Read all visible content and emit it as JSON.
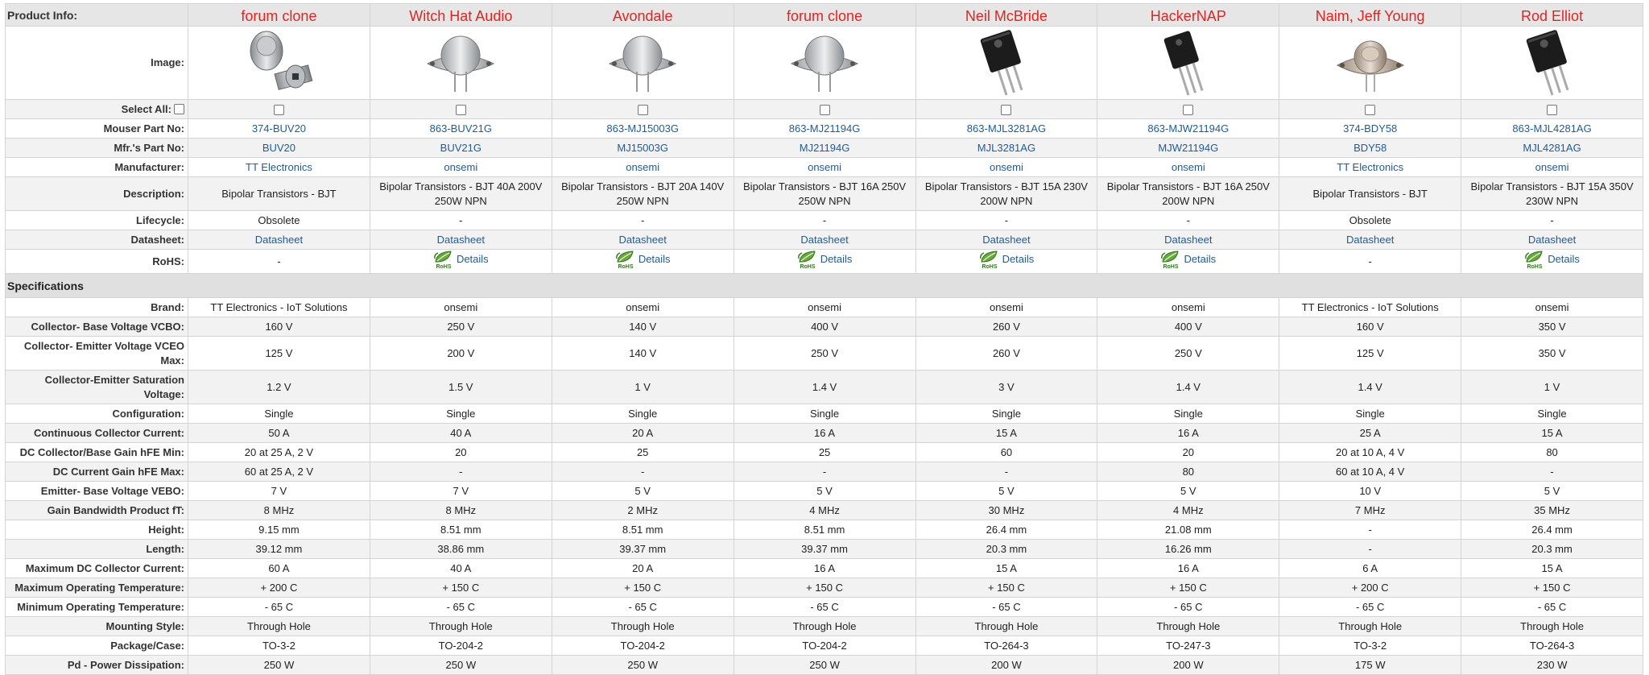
{
  "header_label": "Product Info:",
  "products": [
    {
      "name": "forum clone",
      "image": "to3-pair-image",
      "mouser": "374-BUV20",
      "mfr": "BUV20",
      "manufacturer": "TT Electronics",
      "description": "Bipolar Transistors - BJT",
      "lifecycle": "Obsolete",
      "datasheet": "Datasheet",
      "rohs": "-",
      "rohs_icon": false
    },
    {
      "name": "Witch Hat Audio",
      "image": "to204-image",
      "mouser": "863-BUV21G",
      "mfr": "BUV21G",
      "manufacturer": "onsemi",
      "description": "Bipolar Transistors - BJT 40A 200V 250W NPN",
      "lifecycle": "-",
      "datasheet": "Datasheet",
      "rohs": "Details",
      "rohs_icon": true
    },
    {
      "name": "Avondale",
      "image": "to204-image",
      "mouser": "863-MJ15003G",
      "mfr": "MJ15003G",
      "manufacturer": "onsemi",
      "description": "Bipolar Transistors - BJT 20A 140V 250W NPN",
      "lifecycle": "-",
      "datasheet": "Datasheet",
      "rohs": "Details",
      "rohs_icon": true
    },
    {
      "name": "forum clone",
      "image": "to204-image",
      "mouser": "863-MJ21194G",
      "mfr": "MJ21194G",
      "manufacturer": "onsemi",
      "description": "Bipolar Transistors - BJT 16A 250V 250W NPN",
      "lifecycle": "-",
      "datasheet": "Datasheet",
      "rohs": "Details",
      "rohs_icon": true
    },
    {
      "name": "Neil McBride",
      "image": "to264-image",
      "mouser": "863-MJL3281AG",
      "mfr": "MJL3281AG",
      "manufacturer": "onsemi",
      "description": "Bipolar Transistors - BJT 15A 230V 200W NPN",
      "lifecycle": "-",
      "datasheet": "Datasheet",
      "rohs": "Details",
      "rohs_icon": true
    },
    {
      "name": "HackerNAP",
      "image": "to247-image",
      "mouser": "863-MJW21194G",
      "mfr": "MJW21194G",
      "manufacturer": "onsemi",
      "description": "Bipolar Transistors - BJT 16A 250V 200W NPN",
      "lifecycle": "-",
      "datasheet": "Datasheet",
      "rohs": "Details",
      "rohs_icon": true
    },
    {
      "name": "Naim, Jeff Young",
      "image": "to3-gold-image",
      "mouser": "374-BDY58",
      "mfr": "BDY58",
      "manufacturer": "TT Electronics",
      "description": "Bipolar Transistors - BJT",
      "lifecycle": "Obsolete",
      "datasheet": "Datasheet",
      "rohs": "-",
      "rohs_icon": false
    },
    {
      "name": "Rod Elliot",
      "image": "to264-image",
      "mouser": "863-MJL4281AG",
      "mfr": "MJL4281AG",
      "manufacturer": "onsemi",
      "description": "Bipolar Transistors - BJT 15A 350V 230W NPN",
      "lifecycle": "-",
      "datasheet": "Datasheet",
      "rohs": "Details",
      "rohs_icon": true
    }
  ],
  "labels": {
    "image": "Image:",
    "select_all": "Select All:",
    "mouser": "Mouser Part No:",
    "mfr": "Mfr.'s Part No:",
    "manufacturer": "Manufacturer:",
    "description": "Description:",
    "lifecycle": "Lifecycle:",
    "datasheet": "Datasheet:",
    "rohs": "RoHS:"
  },
  "rohs_icon_text": "RoHS",
  "specs_title": "Specifications",
  "specs": [
    {
      "label": "Brand:",
      "values": [
        "TT Electronics - IoT Solutions",
        "onsemi",
        "onsemi",
        "onsemi",
        "onsemi",
        "onsemi",
        "TT Electronics - IoT Solutions",
        "onsemi"
      ]
    },
    {
      "label": "Collector- Base Voltage VCBO:",
      "values": [
        "160 V",
        "250 V",
        "140 V",
        "400 V",
        "260 V",
        "400 V",
        "160 V",
        "350 V"
      ]
    },
    {
      "label": "Collector- Emitter Voltage VCEO Max:",
      "values": [
        "125 V",
        "200 V",
        "140 V",
        "250 V",
        "260 V",
        "250 V",
        "125 V",
        "350 V"
      ]
    },
    {
      "label": "Collector-Emitter Saturation Voltage:",
      "values": [
        "1.2 V",
        "1.5 V",
        "1 V",
        "1.4 V",
        "3 V",
        "1.4 V",
        "1.4 V",
        "1 V"
      ]
    },
    {
      "label": "Configuration:",
      "values": [
        "Single",
        "Single",
        "Single",
        "Single",
        "Single",
        "Single",
        "Single",
        "Single"
      ]
    },
    {
      "label": "Continuous Collector Current:",
      "values": [
        "50 A",
        "40 A",
        "20 A",
        "16 A",
        "15 A",
        "16 A",
        "25 A",
        "15 A"
      ]
    },
    {
      "label": "DC Collector/Base Gain hFE Min:",
      "values": [
        "20 at 25 A, 2 V",
        "20",
        "25",
        "25",
        "60",
        "20",
        "20 at 10 A, 4 V",
        "80"
      ]
    },
    {
      "label": "DC Current Gain hFE Max:",
      "values": [
        "60 at 25 A, 2 V",
        "-",
        "-",
        "-",
        "-",
        "80",
        "60 at 10 A, 4 V",
        "-"
      ]
    },
    {
      "label": "Emitter- Base Voltage VEBO:",
      "values": [
        "7 V",
        "7 V",
        "5 V",
        "5 V",
        "5 V",
        "5 V",
        "10 V",
        "5 V"
      ]
    },
    {
      "label": "Gain Bandwidth Product fT:",
      "values": [
        "8 MHz",
        "8 MHz",
        "2 MHz",
        "4 MHz",
        "30 MHz",
        "4 MHz",
        "7 MHz",
        "35 MHz"
      ]
    },
    {
      "label": "Height:",
      "values": [
        "9.15 mm",
        "8.51 mm",
        "8.51 mm",
        "8.51 mm",
        "26.4 mm",
        "21.08 mm",
        "-",
        "26.4 mm"
      ]
    },
    {
      "label": "Length:",
      "values": [
        "39.12 mm",
        "38.86 mm",
        "39.37 mm",
        "39.37 mm",
        "20.3 mm",
        "16.26 mm",
        "-",
        "20.3 mm"
      ]
    },
    {
      "label": "Maximum DC Collector Current:",
      "values": [
        "60 A",
        "40 A",
        "20 A",
        "16 A",
        "15 A",
        "16 A",
        "6 A",
        "15 A"
      ]
    },
    {
      "label": "Maximum Operating Temperature:",
      "values": [
        "+ 200 C",
        "+ 150 C",
        "+ 150 C",
        "+ 150 C",
        "+ 150 C",
        "+ 150 C",
        "+ 200 C",
        "+ 150 C"
      ]
    },
    {
      "label": "Minimum Operating Temperature:",
      "values": [
        "- 65 C",
        "- 65 C",
        "- 65 C",
        "- 65 C",
        "- 65 C",
        "- 65 C",
        "- 65 C",
        "- 65 C"
      ]
    },
    {
      "label": "Mounting Style:",
      "values": [
        "Through Hole",
        "Through Hole",
        "Through Hole",
        "Through Hole",
        "Through Hole",
        "Through Hole",
        "Through Hole",
        "Through Hole"
      ]
    },
    {
      "label": "Package/Case:",
      "values": [
        "TO-3-2",
        "TO-204-2",
        "TO-204-2",
        "TO-204-2",
        "TO-264-3",
        "TO-247-3",
        "TO-3-2",
        "TO-264-3"
      ]
    },
    {
      "label": "Pd - Power Dissipation:",
      "values": [
        "250 W",
        "250 W",
        "250 W",
        "250 W",
        "200 W",
        "200 W",
        "175 W",
        "230 W"
      ]
    }
  ]
}
